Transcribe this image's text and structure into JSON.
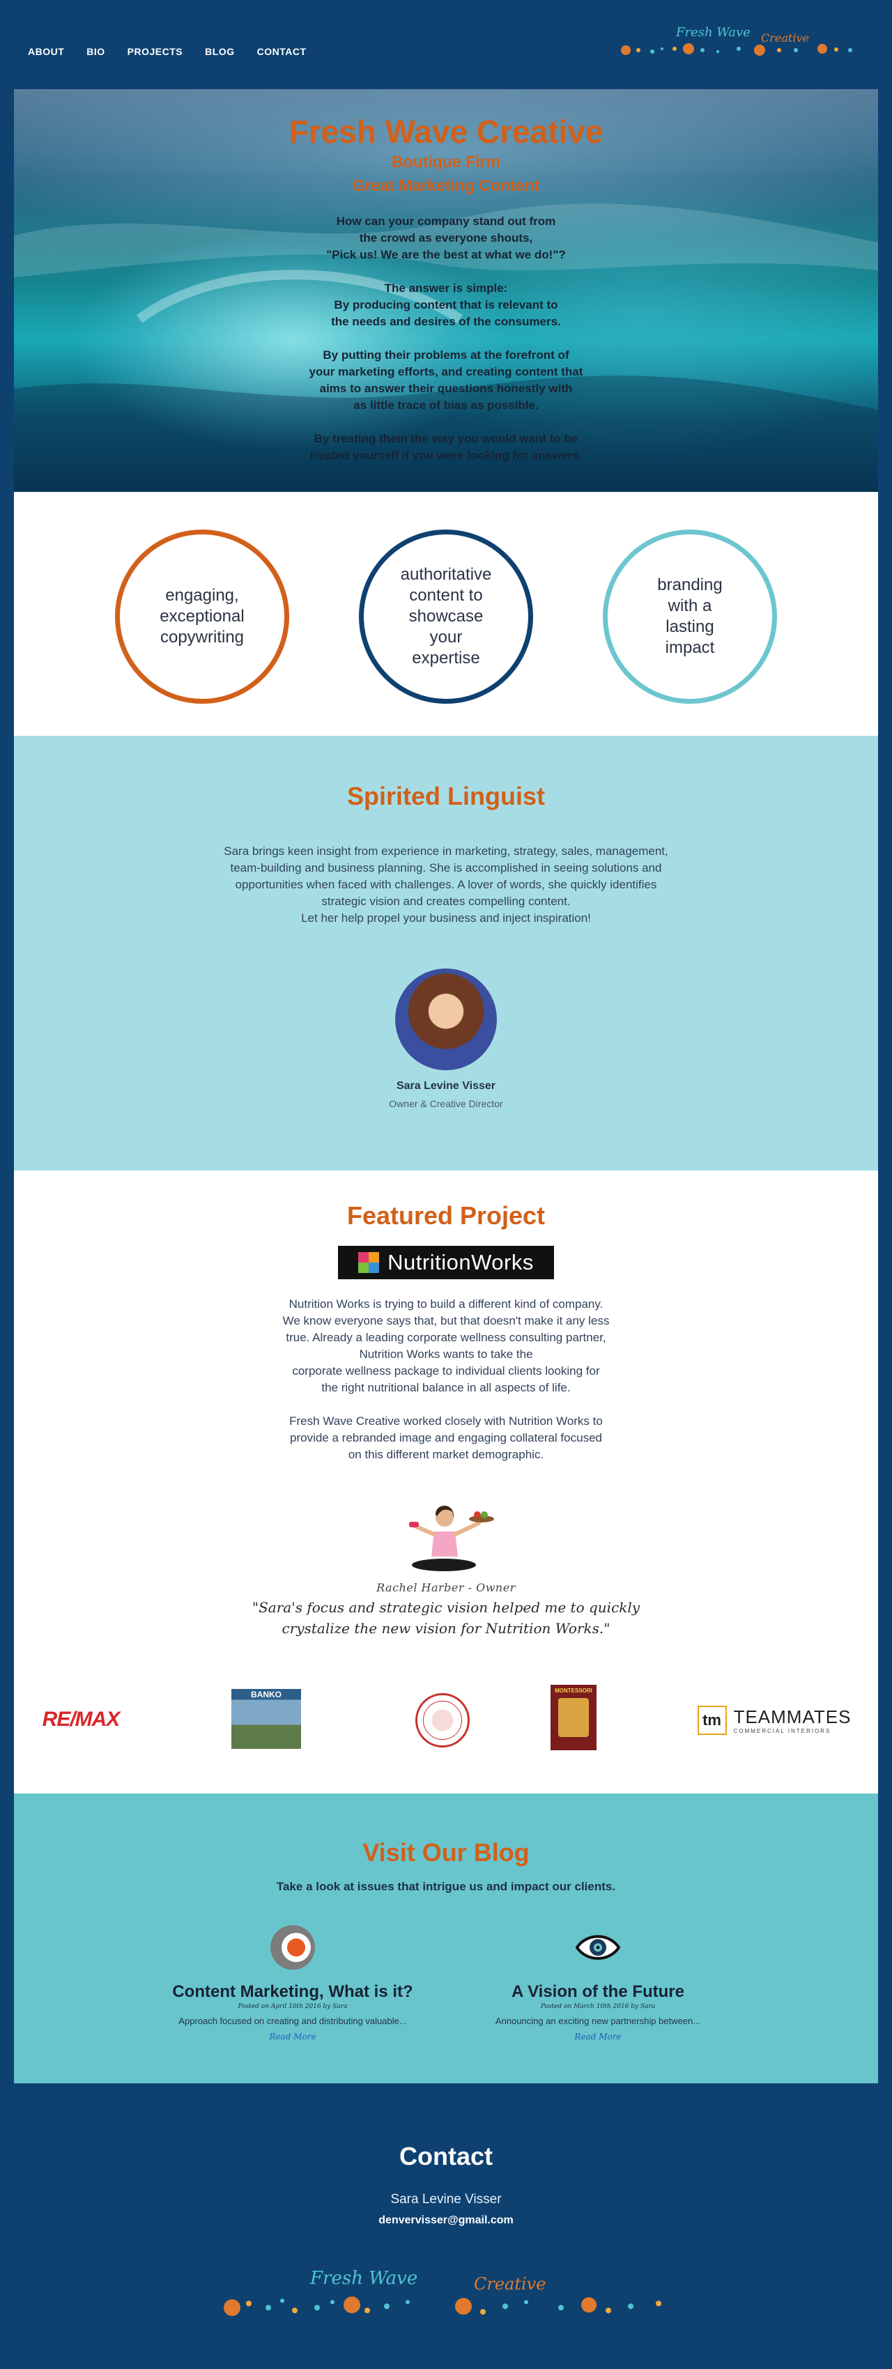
{
  "nav": {
    "links": [
      "ABOUT",
      "BIO",
      "PROJECTS",
      "BLOG",
      "CONTACT"
    ],
    "logo_text": [
      "Fresh Wave",
      "Creative"
    ]
  },
  "hero": {
    "title": "Fresh Wave Creative",
    "subtitle1": "Boutique Firm",
    "subtitle2": "Great Marketing Content",
    "paragraphs": [
      "How can your company stand out from\nthe crowd as everyone shouts,\n\"Pick us!  We are the best at what we do!\"?",
      "The answer is simple:\nBy producing content that is relevant to\nthe needs and desires of the consumers.",
      "By putting their problems at the forefront of\nyour marketing efforts, and creating content that\naims to answer their questions honestly with\nas little trace of bias as possible.",
      "By treating them the way you would want to be\ntreated yourself if you were looking for answers."
    ]
  },
  "circles": [
    {
      "text": "engaging,\nexceptional\ncopywriting",
      "color": "#d2601a"
    },
    {
      "text": "authoritative\ncontent to\nshowcase\nyour\nexpertise",
      "color": "#0e4170"
    },
    {
      "text": "branding\nwith a\nlasting\nimpact",
      "color": "#6cc6cf"
    }
  ],
  "linguist": {
    "title": "Spirited Linguist",
    "body": "Sara brings keen insight from experience in marketing, strategy, sales, management, team-building and business planning.  She is accomplished in seeing solutions and opportunities when faced with challenges.  A lover of words, she quickly identifies strategic vision and creates compelling content.\nLet her help propel your business and inject inspiration!",
    "name": "Sara Levine Visser",
    "role": "Owner & Creative Director"
  },
  "featured": {
    "title": "Featured Project",
    "logo_text": "NutritionWorks",
    "paragraphs": [
      "Nutrition Works is trying to build a different kind of company.\nWe know everyone says that, but that doesn't make it any less\ntrue.  Already a leading corporate wellness consulting partner,\nNutrition Works wants to take the\ncorporate wellness package to individual clients looking for\nthe right nutritional balance in all aspects of life.",
      "Fresh Wave Creative worked closely with Nutrition Works to\nprovide a rebranded image and engaging collateral focused\non this different market demographic."
    ],
    "quote_by": "Rachel Harber - Owner",
    "quote": "\"Sara's focus and strategic vision helped me to quickly crystalize the new vision for Nutrition Works.\""
  },
  "clients": {
    "remax": "RE/MAX",
    "banko": "BANKO",
    "montessori": "MONTESSORI",
    "teammates": "TEAMMATES",
    "teammates_sub": "COMMERCIAL INTERIORS"
  },
  "blog": {
    "title": "Visit Our Blog",
    "tagline": "Take a look at issues that intrigue us and impact our clients.",
    "posts": [
      {
        "title": "Content Marketing, What is it?",
        "meta": "Posted on April 10th 2016 by Sara",
        "excerpt": "Approach focused on creating and distributing valuable...",
        "more": "Read More"
      },
      {
        "title": "A Vision of the Future",
        "meta": "Posted on March 10th 2016 by Sara",
        "excerpt": "Announcing an exciting new partnership between...",
        "more": "Read More"
      }
    ]
  },
  "contact": {
    "title": "Contact",
    "name": "Sara Levine Visser",
    "email": "denvervisser@gmail.com"
  }
}
